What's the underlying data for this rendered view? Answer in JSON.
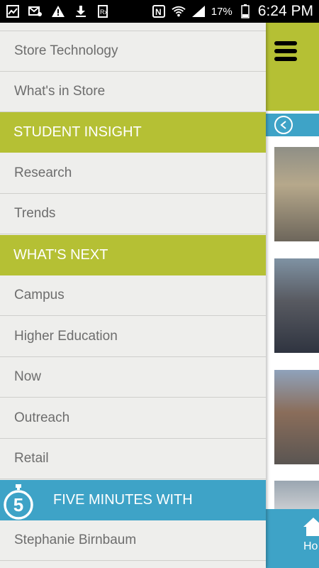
{
  "status_bar": {
    "battery_percent": "17%",
    "time": "6:24 PM",
    "left_icons": [
      "chart-icon",
      "email-muted-icon",
      "warning-icon",
      "download-icon",
      "rx-icon"
    ],
    "right_icons": [
      "nfc-icon",
      "wifi-icon",
      "signal-icon",
      "battery-icon"
    ]
  },
  "drawer": {
    "items": {
      "store_technology": "Store Technology",
      "whats_in_store": "What's in Store",
      "student_insight": "STUDENT INSIGHT",
      "research": "Research",
      "trends": "Trends",
      "whats_next": "WHAT'S NEXT",
      "campus": "Campus",
      "higher_education": "Higher Education",
      "now": "Now",
      "outreach": "Outreach",
      "retail": "Retail",
      "five_minutes_with": "FIVE MINUTES WITH",
      "five_badge": "5",
      "stephanie_birnbaum": "Stephanie Birnbaum"
    }
  },
  "right_panel": {
    "home_label": "Ho"
  },
  "colors": {
    "green": "#b5c034",
    "blue": "#3ea3c7",
    "drawer_bg": "#eeeeec",
    "item_text": "#6d6d6d"
  }
}
